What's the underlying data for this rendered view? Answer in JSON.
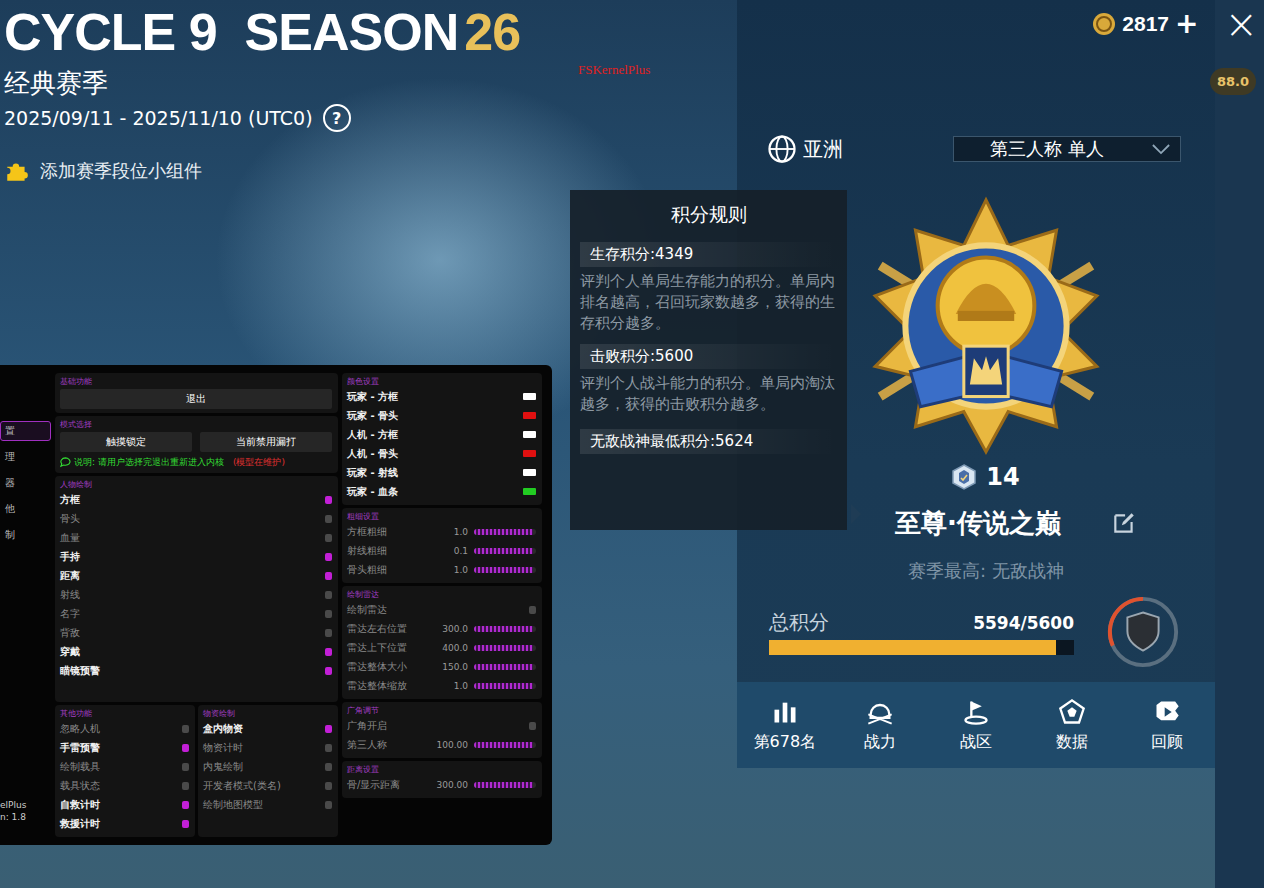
{
  "header": {
    "cycle": "CYCLE 9",
    "season": "SEASON",
    "season_number": "26",
    "mode": "经典赛季",
    "dates": "2025/09/11 - 2025/11/10 (UTC0)",
    "help": "?",
    "widget_link": "添加赛季段位小组件"
  },
  "watermark": "FSKernelPlus",
  "topbar": {
    "currency": "2817",
    "add": "+",
    "close": "×",
    "fps": "88.0"
  },
  "rank_panel": {
    "region": "亚洲",
    "mode_select": "第三人称 单人",
    "tier_stars": "14",
    "tier_name": "至尊·传说之巅",
    "season_best": "赛季最高: 无敌战神",
    "total_label": "总积分",
    "total_reading": "5594/5600",
    "level": 0.94,
    "nav": [
      {
        "label": "第678名",
        "kind": "ranking",
        "selected": false
      },
      {
        "label": "战力",
        "kind": "power",
        "selected": false
      },
      {
        "label": "战区",
        "kind": "zone",
        "selected": false
      },
      {
        "label": "数据",
        "kind": "data",
        "selected": false
      },
      {
        "label": "回顾",
        "kind": "review",
        "selected": false
      }
    ]
  },
  "tooltip": {
    "title": "积分规则",
    "items": [
      {
        "label": "生存积分:4349",
        "desc": "评判个人单局生存能力的积分。单局内排名越高，召回玩家数越多，获得的生存积分越多。"
      },
      {
        "label": "击败积分:5600",
        "desc": "评判个人战斗能力的积分。单局内淘汰越多，获得的击败积分越多。"
      }
    ],
    "footer": "无敌战神最低积分:5624"
  },
  "menu": {
    "sidebar": [
      {
        "label": "置",
        "selected": true
      },
      {
        "label": "理",
        "selected": false
      },
      {
        "label": "器",
        "selected": false
      },
      {
        "label": "他",
        "selected": false
      },
      {
        "label": "制",
        "selected": false
      }
    ],
    "brand": "elPlus",
    "version": "n: 1.8",
    "exit_section": {
      "label": "基础功能",
      "button": "退出"
    },
    "aim_section": {
      "label": "模式选择",
      "buttons": [
        "触摸锁定",
        "当前禁用漏打"
      ],
      "note": "说明: 请用户选择完退出重新进入内核",
      "note_warn": "(模型在维护)"
    },
    "left_sections": [
      {
        "label": "人物绘制",
        "items": [
          {
            "kind": "toggle",
            "label": "方框",
            "on": true
          },
          {
            "kind": "toggle",
            "label": "骨头",
            "on": false
          },
          {
            "kind": "toggle",
            "label": "血量",
            "on": false
          },
          {
            "kind": "toggle",
            "label": "手持",
            "on": true
          },
          {
            "kind": "toggle",
            "label": "距离",
            "on": true
          },
          {
            "kind": "toggle",
            "label": "射线",
            "on": false
          },
          {
            "kind": "toggle",
            "label": "名字",
            "on": false
          },
          {
            "kind": "toggle",
            "label": "背敌",
            "on": false
          },
          {
            "kind": "toggle",
            "label": "穿戴",
            "on": true
          },
          {
            "kind": "toggle",
            "label": "瞄镜预警",
            "on": true
          }
        ]
      }
    ],
    "bottom_sections": [
      {
        "label": "其他功能",
        "items": [
          {
            "kind": "toggle",
            "label": "忽略人机",
            "on": false
          },
          {
            "kind": "toggle",
            "label": "手雷预警",
            "on": true
          },
          {
            "kind": "toggle",
            "label": "绘制载具",
            "on": false
          },
          {
            "kind": "toggle",
            "label": "载具状态",
            "on": false
          },
          {
            "kind": "toggle",
            "label": "自救计时",
            "on": true
          },
          {
            "kind": "toggle",
            "label": "救援计时",
            "on": true
          }
        ]
      },
      {
        "label": "物资绘制",
        "items": [
          {
            "kind": "toggle",
            "label": "盒内物资",
            "on": true
          },
          {
            "kind": "toggle",
            "label": "物资计时",
            "on": false
          },
          {
            "kind": "toggle",
            "label": "内鬼绘制",
            "on": false
          },
          {
            "kind": "toggle",
            "label": "开发者模式(类名)",
            "on": false
          },
          {
            "kind": "toggle",
            "label": "绘制地图模型",
            "on": false
          }
        ]
      }
    ],
    "right_sections": [
      {
        "label": "颜色设置",
        "items": [
          {
            "kind": "swatch",
            "label": "玩家 - 方框",
            "color": "#ffffff"
          },
          {
            "kind": "swatch",
            "label": "玩家 - 骨头",
            "color": "#e01010"
          },
          {
            "kind": "swatch",
            "label": "人机 - 方框",
            "color": "#ffffff"
          },
          {
            "kind": "swatch",
            "label": "人机 - 骨头",
            "color": "#e01010"
          },
          {
            "kind": "swatch",
            "label": "玩家 - 射线",
            "color": "#ffffff"
          },
          {
            "kind": "swatch",
            "label": "玩家 - 血条",
            "color": "#22cc22"
          }
        ]
      },
      {
        "label": "粗细设置",
        "items": [
          {
            "kind": "slider",
            "label": "方框粗细",
            "value": "1.0",
            "level": 0.95
          },
          {
            "kind": "slider",
            "label": "射线粗细",
            "value": "0.1",
            "level": 0.95
          },
          {
            "kind": "slider",
            "label": "骨头粗细",
            "value": "1.0",
            "level": 0.95
          }
        ]
      },
      {
        "label": "绘制雷达",
        "items": [
          {
            "kind": "toggle",
            "label": "绘制雷达",
            "on": false
          },
          {
            "kind": "slider",
            "label": "雷达左右位置",
            "value": "300.0",
            "level": 0.95
          },
          {
            "kind": "slider",
            "label": "雷达上下位置",
            "value": "400.0",
            "level": 0.95
          },
          {
            "kind": "slider",
            "label": "雷达整体大小",
            "value": "150.0",
            "level": 0.95
          },
          {
            "kind": "slider",
            "label": "雷达整体缩放",
            "value": "1.0",
            "level": 0.95
          }
        ]
      },
      {
        "label": "广角调节",
        "items": [
          {
            "kind": "toggle",
            "label": "广角开启",
            "on": false
          },
          {
            "kind": "slider",
            "label": "第三人称",
            "value": "100.00",
            "level": 0.95
          }
        ]
      },
      {
        "label": "距离设置",
        "items": [
          {
            "kind": "slider",
            "label": "骨/显示距离",
            "value": "300.00",
            "level": 0.95
          }
        ]
      }
    ]
  }
}
